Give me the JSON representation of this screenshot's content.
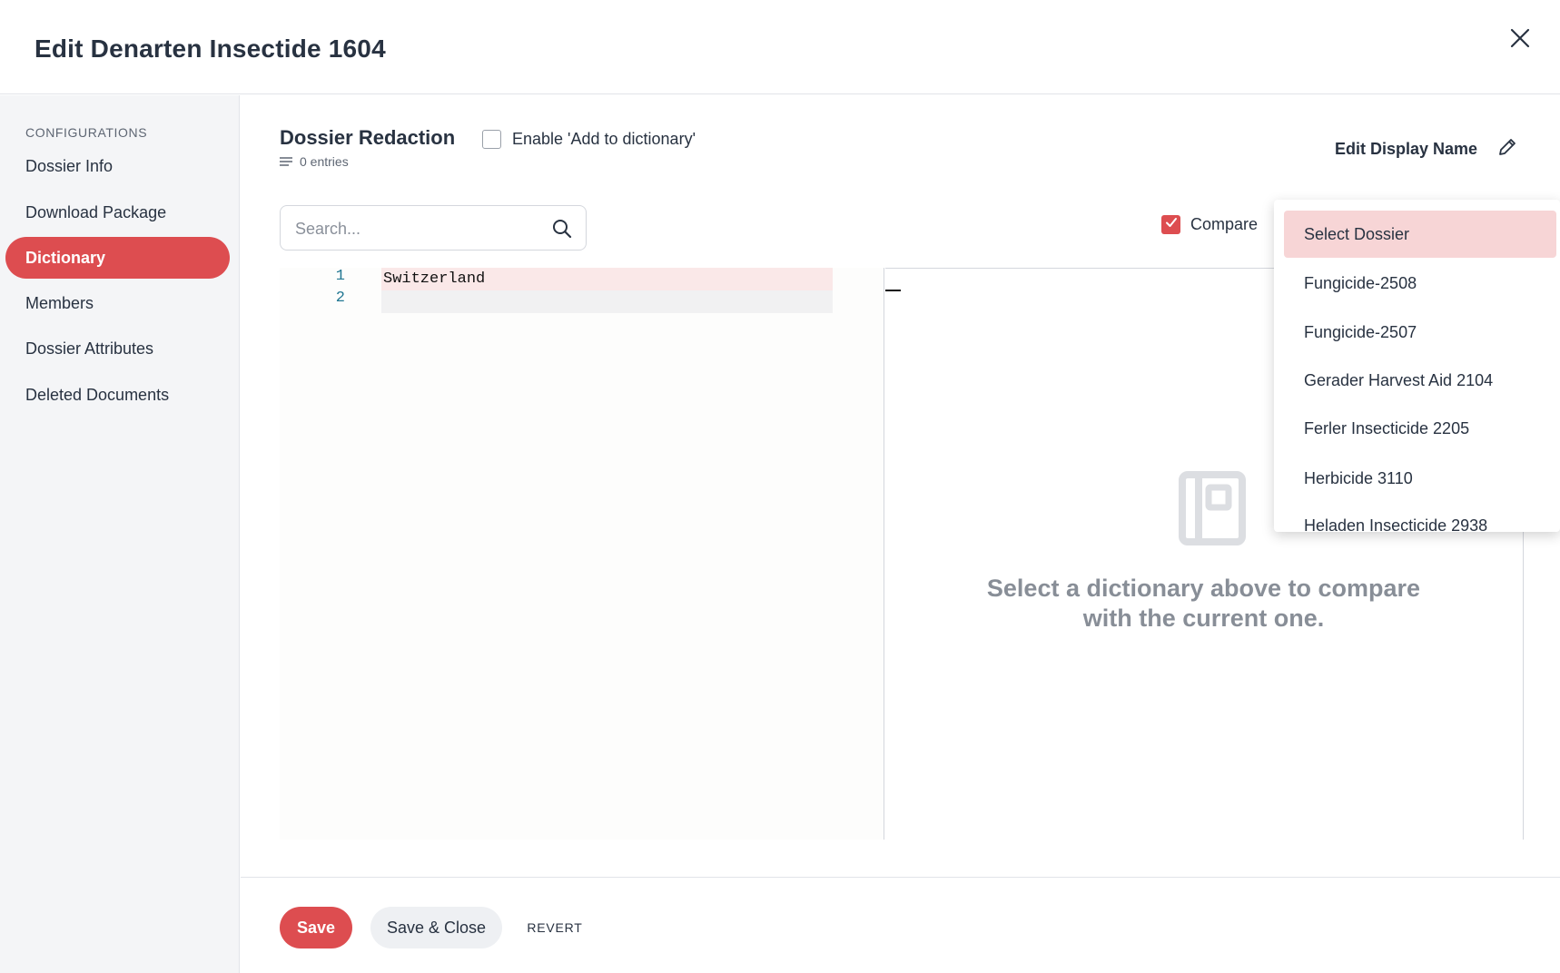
{
  "header": {
    "title": "Edit Denarten Insectide 1604"
  },
  "sidebar": {
    "section_title": "CONFIGURATIONS",
    "items": [
      {
        "label": "Dossier Info"
      },
      {
        "label": "Download Package"
      },
      {
        "label": "Dictionary",
        "active": true
      },
      {
        "label": "Members"
      },
      {
        "label": "Dossier Attributes"
      },
      {
        "label": "Deleted Documents"
      }
    ]
  },
  "main": {
    "section_title": "Dossier Redaction",
    "entries": "0 entries",
    "enable_label": "Enable 'Add to dictionary'",
    "enable_checked": false,
    "edit_display_name": "Edit Display Name",
    "search": {
      "placeholder": "Search...",
      "value": ""
    },
    "compare": {
      "label": "Compare",
      "checked": true
    }
  },
  "editor": {
    "lines": [
      {
        "number": "1",
        "text": "Switzerland"
      },
      {
        "number": "2",
        "text": ""
      }
    ],
    "empty_message": "Select a dictionary above to compare with the current one."
  },
  "dropdown": {
    "options": [
      {
        "label": "Select Dossier",
        "selected": true
      },
      {
        "label": "Fungicide-2508"
      },
      {
        "label": "Fungicide-2507"
      },
      {
        "label": "Gerader Harvest Aid 2104"
      },
      {
        "label": "Ferler Insecticide 2205"
      },
      {
        "label": "Herbicide 3110"
      },
      {
        "label": "Heladen Insecticide 2938"
      }
    ]
  },
  "footer": {
    "save_label": "Save",
    "save_close_label": "Save & Close",
    "revert_label": "REVERT"
  },
  "colors": {
    "accent": "#dd4d50",
    "accent_light": "#f7d5d6",
    "text": "#283241",
    "muted": "#888e97"
  },
  "icons": [
    "close-icon",
    "list-icon",
    "pencil-icon",
    "search-icon",
    "check-icon",
    "dictionary-icon"
  ]
}
